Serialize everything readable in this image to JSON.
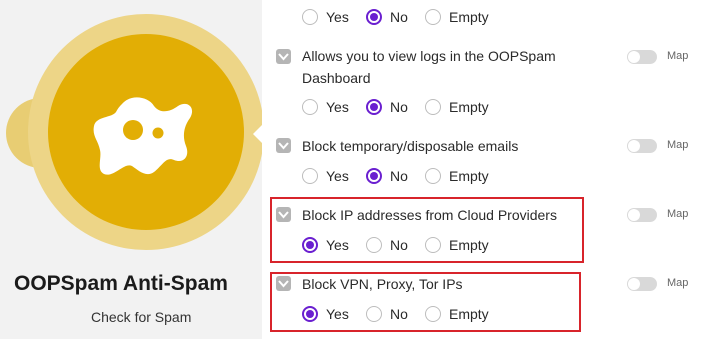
{
  "module": {
    "title": "OOPSpam Anti-Spam",
    "subtitle": "Check for Spam",
    "icon": "ghost-icon",
    "color_primary": "#e2ae05",
    "color_ring": "#edd587"
  },
  "radio_options": [
    "Yes",
    "No",
    "Empty"
  ],
  "map_label": "Map",
  "rows": [
    {
      "label": "",
      "selected": "No"
    },
    {
      "label": "Allows you to view logs in the OOPSpam Dashboard",
      "selected": "No"
    },
    {
      "label": "Block temporary/disposable emails",
      "selected": "No"
    },
    {
      "label": "Block IP addresses from Cloud Providers",
      "selected": "Yes",
      "highlighted": true
    },
    {
      "label": "Block VPN, Proxy, Tor IPs",
      "selected": "Yes",
      "highlighted": true
    }
  ],
  "colors": {
    "accent": "#6a1fd0",
    "highlight": "#d8242b"
  }
}
